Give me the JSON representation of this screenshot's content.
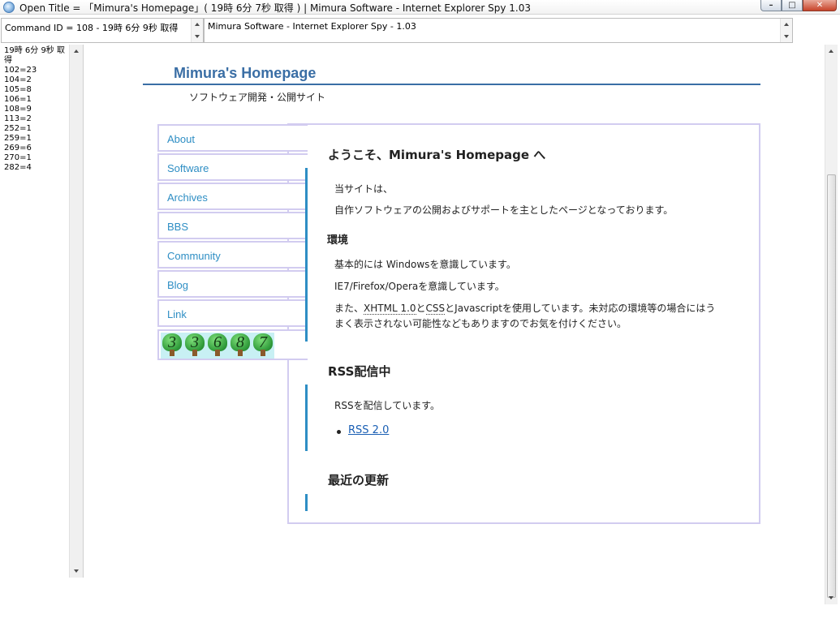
{
  "window": {
    "title": "Open Title = 「Mimura's Homepage」( 19時 6分 7秒 取得 ) | Mimura Software - Internet Explorer Spy 1.03"
  },
  "command_bar": {
    "command_text": "Command ID = 108 - 19時 6分 9秒 取得",
    "spy_text": "Mimura Software - Internet Explorer Spy - 1.03"
  },
  "left_pane": {
    "lines": [
      "19時 6分 9秒 取得",
      "102=23",
      "104=2",
      "105=8",
      "106=1",
      "108=9",
      "113=2",
      "252=1",
      "259=1",
      "269=6",
      "270=1",
      "282=4"
    ]
  },
  "site": {
    "title": "Mimura's Homepage",
    "subtitle": "ソフトウェア開発・公開サイト"
  },
  "nav": {
    "items": [
      {
        "label": "About"
      },
      {
        "label": "Software"
      },
      {
        "label": "Archives"
      },
      {
        "label": "BBS"
      },
      {
        "label": "Community"
      },
      {
        "label": "Blog"
      },
      {
        "label": "Link"
      }
    ]
  },
  "counter": {
    "digits": [
      "3",
      "3",
      "6",
      "8",
      "7"
    ]
  },
  "content": {
    "welcome_heading": "ようこそ、Mimura's Homepage へ",
    "intro_line1": "当サイトは、",
    "intro_line2": "自作ソフトウェアの公開およびサポートを主としたページとなっております。",
    "env_heading": "環境",
    "env_line1": "基本的には Windowsを意識しています。",
    "env_line2": "IE7/Firefox/Operaを意識しています。",
    "env_line3_pre": "また、",
    "env_line3_xhtml": "XHTML 1.0",
    "env_line3_mid": "と",
    "env_line3_css": "CSS",
    "env_line3_post": "とJavascriptを使用しています。未対応の環境等の場合にはう",
    "env_line4": "まく表示されない可能性などもありますのでお気を付けください。",
    "rss_heading": "RSS配信中",
    "rss_line": "RSSを配信しています。",
    "rss_link": "RSS 2.0",
    "updates_heading": "最近の更新"
  }
}
